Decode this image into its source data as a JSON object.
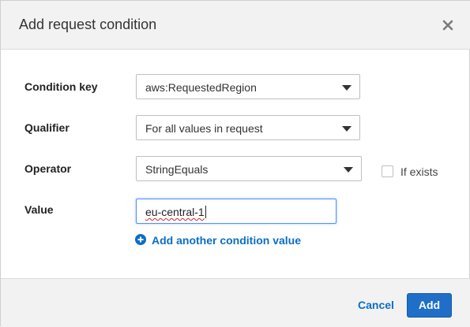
{
  "dialog": {
    "title": "Add request condition",
    "close_icon": "close-icon"
  },
  "form": {
    "condition_key": {
      "label": "Condition key",
      "value": "aws:RequestedRegion"
    },
    "qualifier": {
      "label": "Qualifier",
      "value": "For all values in request"
    },
    "operator": {
      "label": "Operator",
      "value": "StringEquals",
      "if_exists_label": "If exists",
      "if_exists_checked": false
    },
    "value": {
      "label": "Value",
      "current_value": "eu-central-1"
    },
    "add_value_link": "Add another condition value"
  },
  "footer": {
    "cancel_label": "Cancel",
    "add_label": "Add"
  },
  "colors": {
    "link": "#0b6ec5",
    "primary_button": "#1f6fc9",
    "focus_border": "#4d90fe",
    "header_bg": "#f2f2f2"
  }
}
